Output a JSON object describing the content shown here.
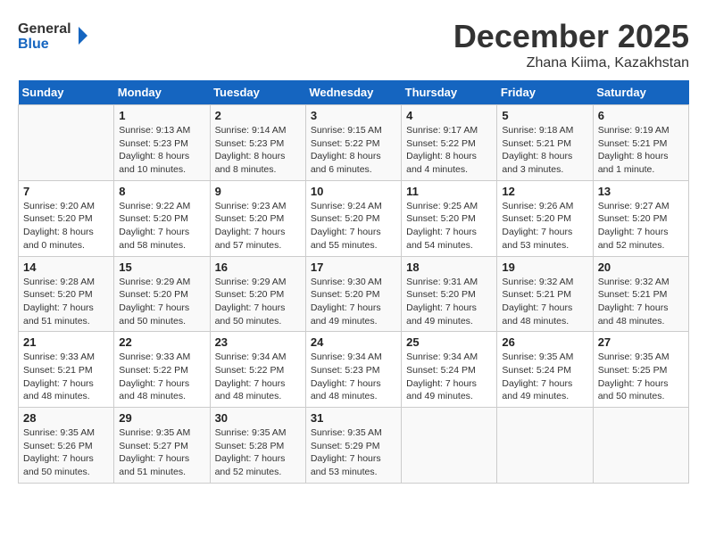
{
  "header": {
    "logo_line1": "General",
    "logo_line2": "Blue",
    "month": "December 2025",
    "location": "Zhana Kiima, Kazakhstan"
  },
  "days_of_week": [
    "Sunday",
    "Monday",
    "Tuesday",
    "Wednesday",
    "Thursday",
    "Friday",
    "Saturday"
  ],
  "weeks": [
    [
      {
        "day": "",
        "sunrise": "",
        "sunset": "",
        "daylight": ""
      },
      {
        "day": "1",
        "sunrise": "Sunrise: 9:13 AM",
        "sunset": "Sunset: 5:23 PM",
        "daylight": "Daylight: 8 hours and 10 minutes."
      },
      {
        "day": "2",
        "sunrise": "Sunrise: 9:14 AM",
        "sunset": "Sunset: 5:23 PM",
        "daylight": "Daylight: 8 hours and 8 minutes."
      },
      {
        "day": "3",
        "sunrise": "Sunrise: 9:15 AM",
        "sunset": "Sunset: 5:22 PM",
        "daylight": "Daylight: 8 hours and 6 minutes."
      },
      {
        "day": "4",
        "sunrise": "Sunrise: 9:17 AM",
        "sunset": "Sunset: 5:22 PM",
        "daylight": "Daylight: 8 hours and 4 minutes."
      },
      {
        "day": "5",
        "sunrise": "Sunrise: 9:18 AM",
        "sunset": "Sunset: 5:21 PM",
        "daylight": "Daylight: 8 hours and 3 minutes."
      },
      {
        "day": "6",
        "sunrise": "Sunrise: 9:19 AM",
        "sunset": "Sunset: 5:21 PM",
        "daylight": "Daylight: 8 hours and 1 minute."
      }
    ],
    [
      {
        "day": "7",
        "sunrise": "Sunrise: 9:20 AM",
        "sunset": "Sunset: 5:20 PM",
        "daylight": "Daylight: 8 hours and 0 minutes."
      },
      {
        "day": "8",
        "sunrise": "Sunrise: 9:22 AM",
        "sunset": "Sunset: 5:20 PM",
        "daylight": "Daylight: 7 hours and 58 minutes."
      },
      {
        "day": "9",
        "sunrise": "Sunrise: 9:23 AM",
        "sunset": "Sunset: 5:20 PM",
        "daylight": "Daylight: 7 hours and 57 minutes."
      },
      {
        "day": "10",
        "sunrise": "Sunrise: 9:24 AM",
        "sunset": "Sunset: 5:20 PM",
        "daylight": "Daylight: 7 hours and 55 minutes."
      },
      {
        "day": "11",
        "sunrise": "Sunrise: 9:25 AM",
        "sunset": "Sunset: 5:20 PM",
        "daylight": "Daylight: 7 hours and 54 minutes."
      },
      {
        "day": "12",
        "sunrise": "Sunrise: 9:26 AM",
        "sunset": "Sunset: 5:20 PM",
        "daylight": "Daylight: 7 hours and 53 minutes."
      },
      {
        "day": "13",
        "sunrise": "Sunrise: 9:27 AM",
        "sunset": "Sunset: 5:20 PM",
        "daylight": "Daylight: 7 hours and 52 minutes."
      }
    ],
    [
      {
        "day": "14",
        "sunrise": "Sunrise: 9:28 AM",
        "sunset": "Sunset: 5:20 PM",
        "daylight": "Daylight: 7 hours and 51 minutes."
      },
      {
        "day": "15",
        "sunrise": "Sunrise: 9:29 AM",
        "sunset": "Sunset: 5:20 PM",
        "daylight": "Daylight: 7 hours and 50 minutes."
      },
      {
        "day": "16",
        "sunrise": "Sunrise: 9:29 AM",
        "sunset": "Sunset: 5:20 PM",
        "daylight": "Daylight: 7 hours and 50 minutes."
      },
      {
        "day": "17",
        "sunrise": "Sunrise: 9:30 AM",
        "sunset": "Sunset: 5:20 PM",
        "daylight": "Daylight: 7 hours and 49 minutes."
      },
      {
        "day": "18",
        "sunrise": "Sunrise: 9:31 AM",
        "sunset": "Sunset: 5:20 PM",
        "daylight": "Daylight: 7 hours and 49 minutes."
      },
      {
        "day": "19",
        "sunrise": "Sunrise: 9:32 AM",
        "sunset": "Sunset: 5:21 PM",
        "daylight": "Daylight: 7 hours and 48 minutes."
      },
      {
        "day": "20",
        "sunrise": "Sunrise: 9:32 AM",
        "sunset": "Sunset: 5:21 PM",
        "daylight": "Daylight: 7 hours and 48 minutes."
      }
    ],
    [
      {
        "day": "21",
        "sunrise": "Sunrise: 9:33 AM",
        "sunset": "Sunset: 5:21 PM",
        "daylight": "Daylight: 7 hours and 48 minutes."
      },
      {
        "day": "22",
        "sunrise": "Sunrise: 9:33 AM",
        "sunset": "Sunset: 5:22 PM",
        "daylight": "Daylight: 7 hours and 48 minutes."
      },
      {
        "day": "23",
        "sunrise": "Sunrise: 9:34 AM",
        "sunset": "Sunset: 5:22 PM",
        "daylight": "Daylight: 7 hours and 48 minutes."
      },
      {
        "day": "24",
        "sunrise": "Sunrise: 9:34 AM",
        "sunset": "Sunset: 5:23 PM",
        "daylight": "Daylight: 7 hours and 48 minutes."
      },
      {
        "day": "25",
        "sunrise": "Sunrise: 9:34 AM",
        "sunset": "Sunset: 5:24 PM",
        "daylight": "Daylight: 7 hours and 49 minutes."
      },
      {
        "day": "26",
        "sunrise": "Sunrise: 9:35 AM",
        "sunset": "Sunset: 5:24 PM",
        "daylight": "Daylight: 7 hours and 49 minutes."
      },
      {
        "day": "27",
        "sunrise": "Sunrise: 9:35 AM",
        "sunset": "Sunset: 5:25 PM",
        "daylight": "Daylight: 7 hours and 50 minutes."
      }
    ],
    [
      {
        "day": "28",
        "sunrise": "Sunrise: 9:35 AM",
        "sunset": "Sunset: 5:26 PM",
        "daylight": "Daylight: 7 hours and 50 minutes."
      },
      {
        "day": "29",
        "sunrise": "Sunrise: 9:35 AM",
        "sunset": "Sunset: 5:27 PM",
        "daylight": "Daylight: 7 hours and 51 minutes."
      },
      {
        "day": "30",
        "sunrise": "Sunrise: 9:35 AM",
        "sunset": "Sunset: 5:28 PM",
        "daylight": "Daylight: 7 hours and 52 minutes."
      },
      {
        "day": "31",
        "sunrise": "Sunrise: 9:35 AM",
        "sunset": "Sunset: 5:29 PM",
        "daylight": "Daylight: 7 hours and 53 minutes."
      },
      {
        "day": "",
        "sunrise": "",
        "sunset": "",
        "daylight": ""
      },
      {
        "day": "",
        "sunrise": "",
        "sunset": "",
        "daylight": ""
      },
      {
        "day": "",
        "sunrise": "",
        "sunset": "",
        "daylight": ""
      }
    ]
  ]
}
